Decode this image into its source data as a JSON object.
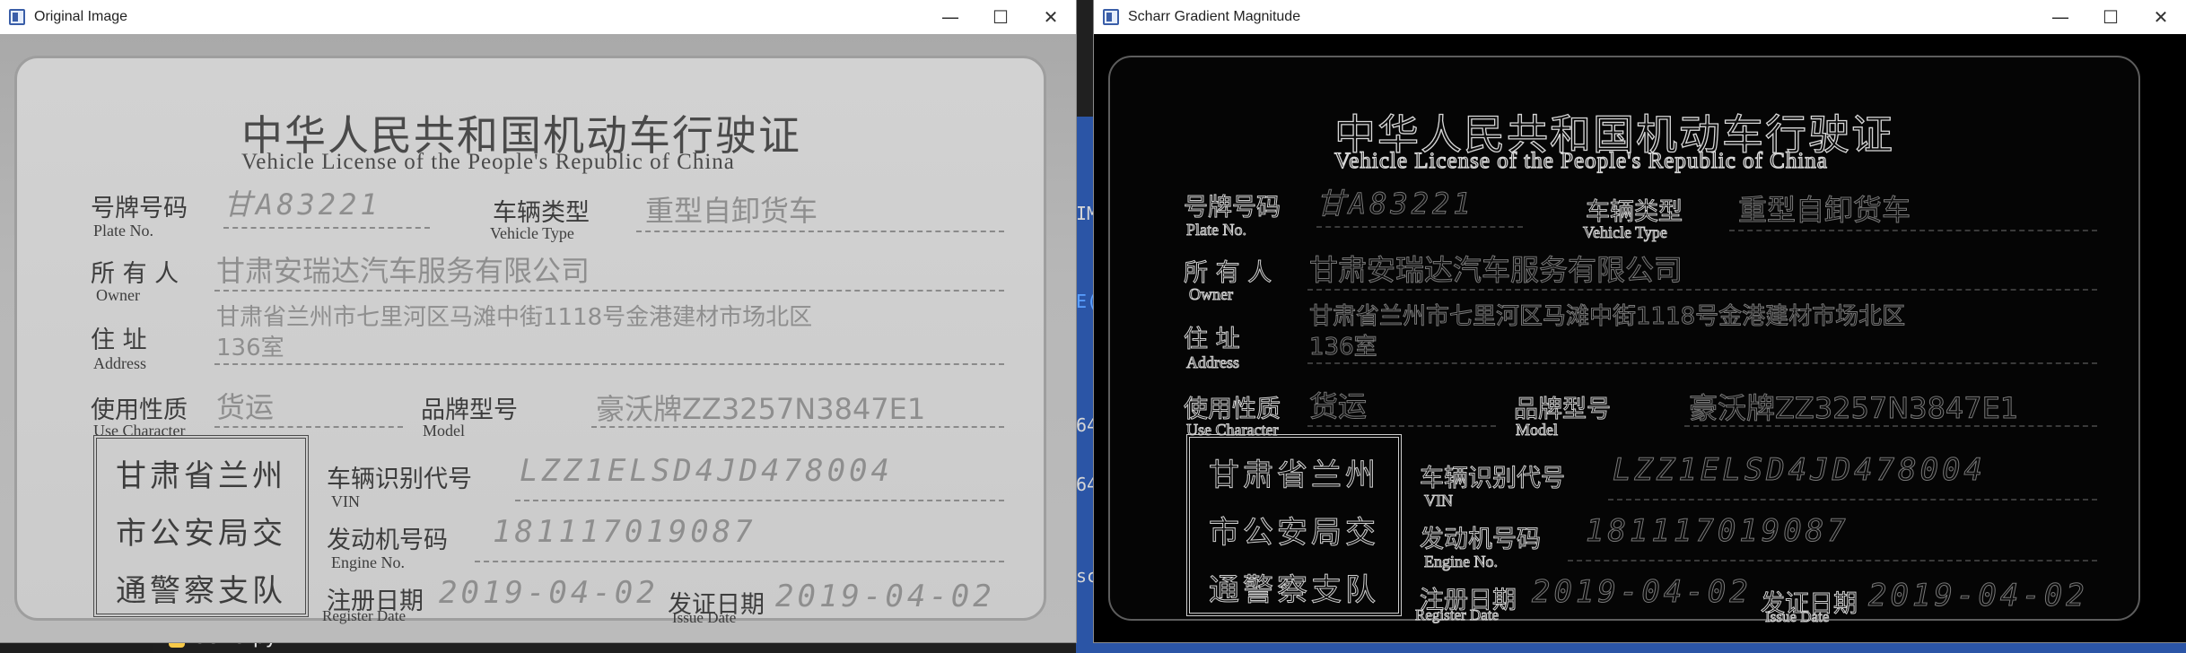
{
  "background_ide": {
    "code_fragments": [
      "IM",
      "E(",
      "64",
      "64",
      "sc"
    ],
    "file_tab": "OSTU.py"
  },
  "windows": [
    {
      "title": "Original Image",
      "controls": {
        "minimize": "—",
        "maximize": "☐",
        "close": "✕"
      }
    },
    {
      "title": "Scharr Gradient Magnitude",
      "controls": {
        "minimize": "—",
        "maximize": "☐",
        "close": "✕"
      }
    }
  ],
  "license": {
    "title_cn": "中华人民共和国机动车行驶证",
    "title_en": "Vehicle License of the People's Republic of China",
    "plate_label_cn": "号牌号码",
    "plate_label_en": "Plate No.",
    "plate_value": "甘A83221",
    "vehicle_type_label_cn": "车辆类型",
    "vehicle_type_label_en": "Vehicle Type",
    "vehicle_type_value": "重型自卸货车",
    "owner_label_cn": "所 有 人",
    "owner_label_en": "Owner",
    "owner_value": "甘肃安瑞达汽车服务有限公司",
    "address_label_cn": "住       址",
    "address_label_en": "Address",
    "address_value_line1": "甘肃省兰州市七里河区马滩中街1118号金港建材市场北区",
    "address_value_line2": "136室",
    "use_label_cn": "使用性质",
    "use_label_en": "Use Character",
    "use_value": "货运",
    "model_label_cn": "品牌型号",
    "model_label_en": "Model",
    "model_value": "豪沃牌ZZ3257N3847E1",
    "vin_label_cn": "车辆识别代号",
    "vin_label_en": "VIN",
    "vin_value": "LZZ1ELSD4JD478004",
    "engine_label_cn": "发动机号码",
    "engine_label_en": "Engine No.",
    "engine_value": "181117019087",
    "register_label_cn": "注册日期",
    "register_label_en": "Register Date",
    "register_value": "2019-04-02",
    "issue_label_cn": "发证日期",
    "issue_label_en": "Issue Date",
    "issue_value": "2019-04-02",
    "seal_line1": "甘肃省兰州",
    "seal_line2": "市公安局交",
    "seal_line3": "通警察支队"
  }
}
